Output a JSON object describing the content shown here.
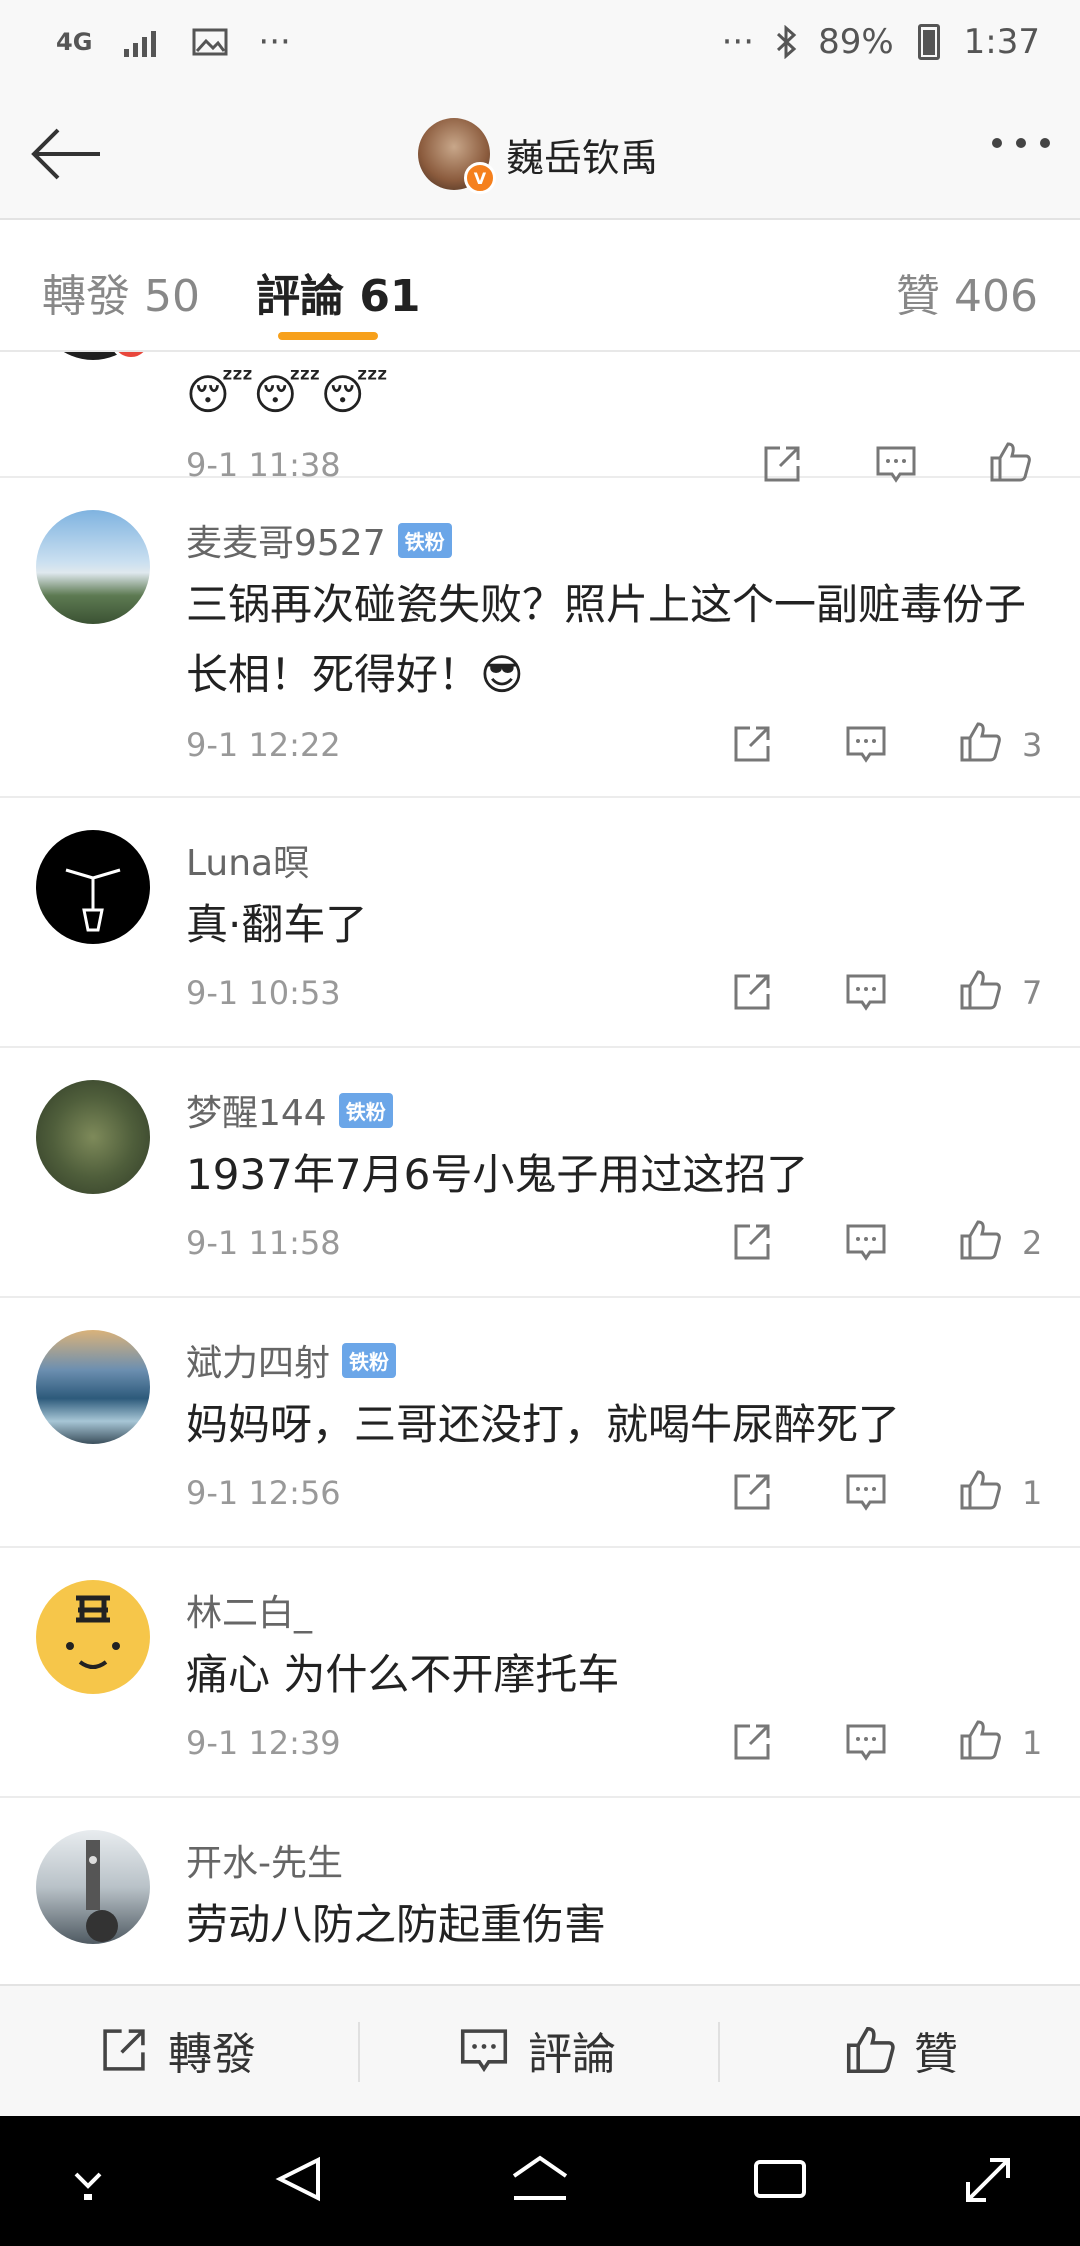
{
  "status": {
    "network": "4G",
    "battery": "89%",
    "time": "1:37"
  },
  "header": {
    "title": "巍岳钦禹"
  },
  "tabs": [
    {
      "label": "轉發 50"
    },
    {
      "label": "評論 61"
    },
    {
      "label": "贊 406"
    }
  ],
  "comments": [
    {
      "user": "",
      "badge": "",
      "text": "😴😴😴",
      "time": "9-1 11:38",
      "likes": ""
    },
    {
      "user": "麦麦哥9527",
      "badge": "铁粉",
      "text": "三锅再次碰瓷失败？照片上这个一副赃毒份子长相！死得好！😎",
      "time": "9-1 12:22",
      "likes": "3"
    },
    {
      "user": "Luna暝",
      "badge": "",
      "text": "真·翻车了",
      "time": "9-1 10:53",
      "likes": "7"
    },
    {
      "user": "梦醒144",
      "badge": "铁粉",
      "text": "1937年7月6号小鬼子用过这招了",
      "time": "9-1 11:58",
      "likes": "2"
    },
    {
      "user": "斌力四射",
      "badge": "铁粉",
      "text": "妈妈呀，三哥还没打，就喝牛尿醉死了",
      "time": "9-1 12:56",
      "likes": "1"
    },
    {
      "user": "林二白_",
      "badge": "",
      "text": "痛心 为什么不开摩托车",
      "time": "9-1 12:39",
      "likes": "1"
    },
    {
      "user": "开水-先生",
      "badge": "",
      "text": "劳动八防之防起重伤害",
      "time": "",
      "likes": ""
    }
  ],
  "bottom": {
    "repost": "轉發",
    "comment": "評論",
    "like": "贊"
  },
  "colors": {
    "accent": "#f7a01b",
    "badge": "#6ba6e8"
  }
}
